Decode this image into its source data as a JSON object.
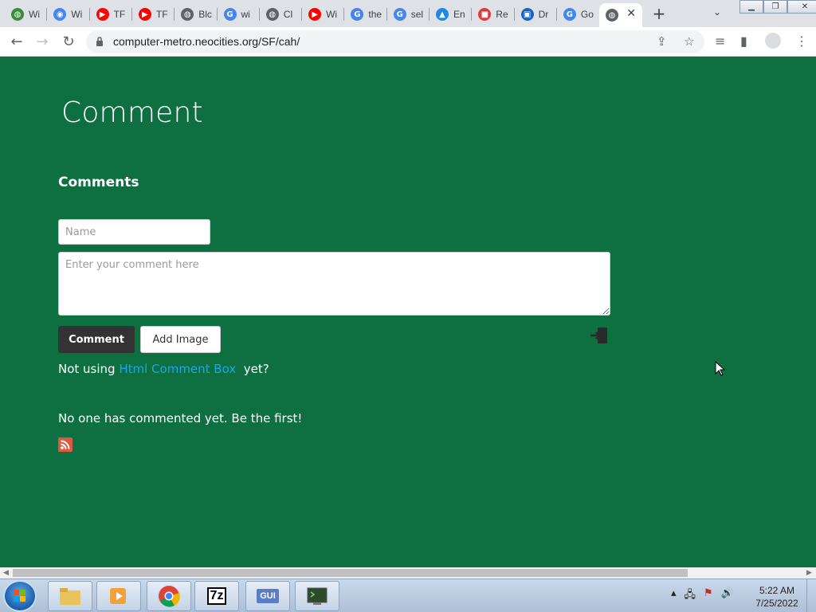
{
  "browser": {
    "tabs": [
      {
        "label": "Wi",
        "favicon": "globe-icon",
        "color": "#3b8b3b"
      },
      {
        "label": "Wi",
        "favicon": "chrome-icon",
        "color": "#4285f4"
      },
      {
        "label": "TF",
        "favicon": "youtube-icon",
        "color": "#ff0000"
      },
      {
        "label": "TF",
        "favicon": "youtube-icon",
        "color": "#ff0000"
      },
      {
        "label": "Blc",
        "favicon": "globe-icon",
        "color": "#5f6368"
      },
      {
        "label": "wi",
        "favicon": "google-icon",
        "color": "#4285f4"
      },
      {
        "label": "Cl",
        "favicon": "globe-icon",
        "color": "#5f6368"
      },
      {
        "label": "Wi",
        "favicon": "youtube-icon",
        "color": "#ff0000"
      },
      {
        "label": "the",
        "favicon": "google-icon",
        "color": "#4285f4"
      },
      {
        "label": "sel",
        "favicon": "google-icon",
        "color": "#4285f4"
      },
      {
        "label": "En",
        "favicon": "image-icon",
        "color": "#1e88e5"
      },
      {
        "label": "Re",
        "favicon": "app-icon",
        "color": "#e53935"
      },
      {
        "label": "Dr",
        "favicon": "doc-icon",
        "color": "#1565c0"
      },
      {
        "label": "Go",
        "favicon": "google-icon",
        "color": "#4285f4"
      }
    ],
    "active_tab": {
      "favicon": "globe-icon",
      "close": "✕"
    },
    "new_tab": "+",
    "tab_dropdown": "⌄",
    "window_controls": {
      "minimize": "▁",
      "maximize": "❐",
      "close": "✕"
    },
    "url": "computer-metro.neocities.org/SF/cah/"
  },
  "page": {
    "title": "Comment",
    "comments_heading": "Comments",
    "name_placeholder": "Name",
    "comment_placeholder": "Enter your comment here",
    "comment_button": "Comment",
    "add_image_button": "Add Image",
    "not_using_prefix": "Not using ",
    "not_using_link": "Html Comment Box",
    "not_using_suffix": "  yet?",
    "no_comments": "No one has commented yet. Be the first!"
  },
  "taskbar": {
    "time": "5:22 AM",
    "date": "7/25/2022"
  },
  "colors": {
    "page_background": "#0e7040",
    "link": "#1ea4e9",
    "comment_button": "#333333",
    "rss": "#e2583e"
  }
}
